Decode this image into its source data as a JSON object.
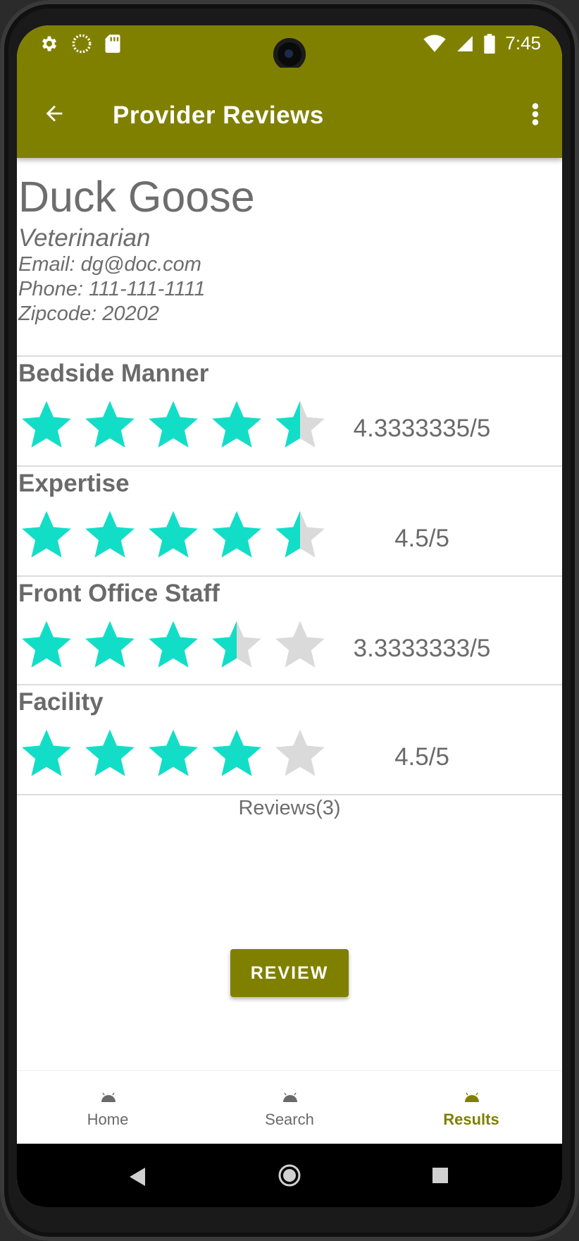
{
  "status_bar": {
    "time": "7:45"
  },
  "app_bar": {
    "title": "Provider Reviews"
  },
  "provider": {
    "name": "Duck Goose",
    "type": "Veterinarian",
    "email": "Email: dg@doc.com",
    "phone": "Phone: 111-111-1111",
    "zipcode": "Zipcode: 20202"
  },
  "ratings": [
    {
      "label": "Bedside Manner",
      "value": "4.3333335/5",
      "stars_filled": 4.5
    },
    {
      "label": "Expertise",
      "value": "4.5/5",
      "stars_filled": 4.5
    },
    {
      "label": "Front Office Staff",
      "value": "3.3333333/5",
      "stars_filled": 3.5
    },
    {
      "label": "Facility",
      "value": "4.5/5",
      "stars_filled": 4.0
    }
  ],
  "reviews_count": "Reviews(3)",
  "review_button": "REVIEW",
  "bottom_nav": [
    {
      "label": "Home",
      "active": false
    },
    {
      "label": "Search",
      "active": false
    },
    {
      "label": "Results",
      "active": true
    }
  ],
  "colors": {
    "primary": "#808000",
    "star_on": "#12DEC8",
    "star_off": "#DADADA"
  }
}
